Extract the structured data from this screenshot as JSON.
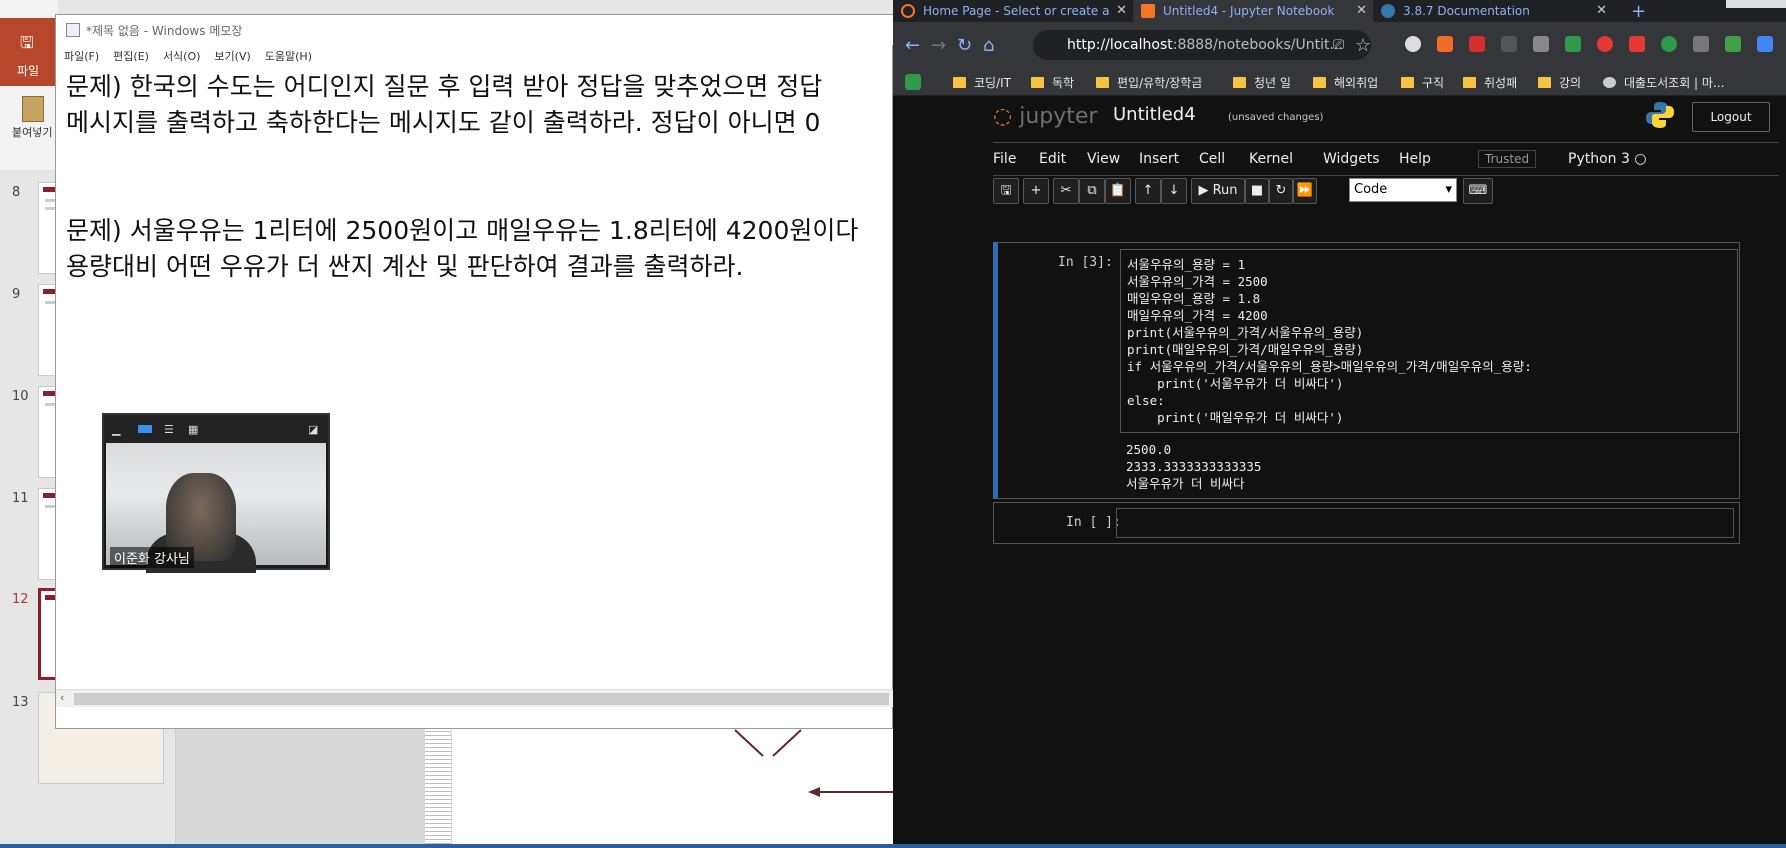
{
  "powerpoint": {
    "file_label": "파일",
    "paste_label": "붙여넣기",
    "slide_numbers": [
      "8",
      "9",
      "10",
      "11",
      "12",
      "13"
    ]
  },
  "notepad": {
    "title": "*제목 없음 - Windows 메모장",
    "menu": [
      "파일(F)",
      "편집(E)",
      "서식(O)",
      "보기(V)",
      "도움말(H)"
    ],
    "text": "문제) 한국의 수도는 어디인지 질문 후 입력 받아 정답을 맞추었으면 정답\n메시지를 출력하고 축하한다는 메시지도 같이 출력하라. 정답이 아니면 0\n\n\n문제) 서울우유는 1리터에 2500원이고 매일우유는 1.8리터에 4200원이다\n용량대비 어떤 우유가 더 싼지 계산 및 판단하여 결과를 출력하라."
  },
  "video": {
    "name": "이준화 강사님"
  },
  "chrome": {
    "tabs": [
      {
        "title": "Home Page - Select or create a",
        "color": "#f37726"
      },
      {
        "title": "Untitled4 - Jupyter Notebook",
        "color": "#f37726"
      },
      {
        "title": "3.8.7 Documentation",
        "color": "#3776ab"
      }
    ],
    "new_tab": "+",
    "url_host": "http://localhost",
    "url_rest": ":8888/notebooks/Untit...",
    "bookmarks": [
      "코딩/IT",
      "독학",
      "편입/유학/장학금",
      "청년 일",
      "해외취업",
      "구직",
      "취성패",
      "강의",
      "대출도서조회 | 마..."
    ]
  },
  "jupyter": {
    "logo": "jupyter",
    "notebook_name": "Untitled4",
    "status": "(unsaved changes)",
    "logout": "Logout",
    "menu": [
      "File",
      "Edit",
      "View",
      "Insert",
      "Cell",
      "Kernel",
      "Widgets",
      "Help"
    ],
    "trusted": "Trusted",
    "kernel": "Python 3",
    "run_label": "Run",
    "cell_type": "Code",
    "cell1_prompt": "In [3]:",
    "cell1_code": [
      "서울우유의_용량 = 1",
      "서울우유의_가격 = 2500",
      "매일우유의_용량 = 1.8",
      "매일우유의_가격 = 4200",
      "print(서울우유의_가격/서울우유의_용량)",
      "print(매일우유의_가격/매일우유의_용량)",
      "if 서울우유의_가격/서울우유의_용량>매일우유의_가격/매일우유의_용량:",
      "    print('서울우유가 더 비싸다')",
      "else:",
      "    print('매일우유가 더 비싸다')"
    ],
    "cell1_output": [
      "2500.0",
      "2333.3333333333335",
      "서울우유가 더 비싸다"
    ],
    "cell2_prompt": "In [ ]:"
  }
}
